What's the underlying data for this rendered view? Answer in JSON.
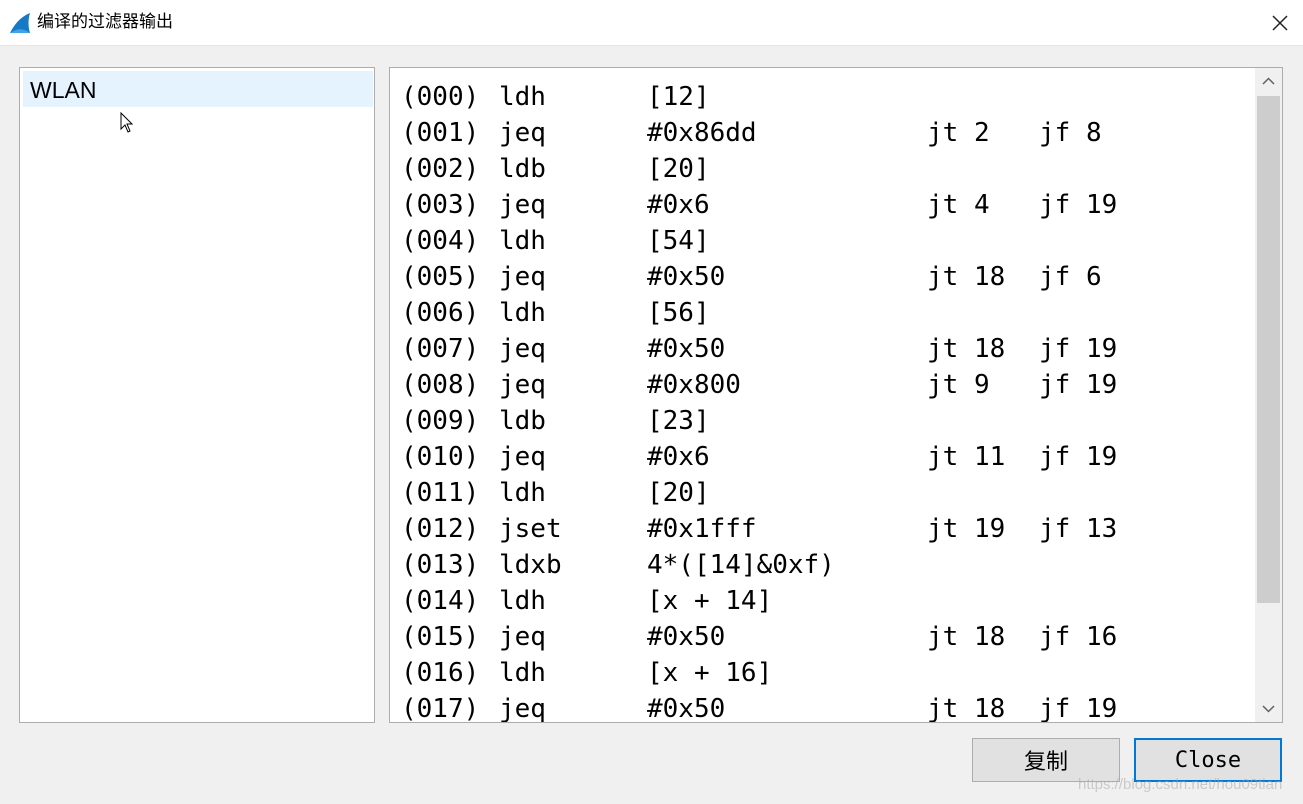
{
  "window": {
    "title": "编译的过滤器输出",
    "icon": "wireshark-fin-icon",
    "accent": "#0078d7"
  },
  "interfaces": {
    "items": [
      {
        "label": "WLAN",
        "selected": true
      }
    ]
  },
  "code": {
    "lines": [
      {
        "idx": "(000)",
        "op": "ldh",
        "arg": "[12]",
        "jt": "",
        "jf": ""
      },
      {
        "idx": "(001)",
        "op": "jeq",
        "arg": "#0x86dd",
        "jt": "jt 2",
        "jf": "jf 8"
      },
      {
        "idx": "(002)",
        "op": "ldb",
        "arg": "[20]",
        "jt": "",
        "jf": ""
      },
      {
        "idx": "(003)",
        "op": "jeq",
        "arg": "#0x6",
        "jt": "jt 4",
        "jf": "jf 19"
      },
      {
        "idx": "(004)",
        "op": "ldh",
        "arg": "[54]",
        "jt": "",
        "jf": ""
      },
      {
        "idx": "(005)",
        "op": "jeq",
        "arg": "#0x50",
        "jt": "jt 18",
        "jf": "jf 6"
      },
      {
        "idx": "(006)",
        "op": "ldh",
        "arg": "[56]",
        "jt": "",
        "jf": ""
      },
      {
        "idx": "(007)",
        "op": "jeq",
        "arg": "#0x50",
        "jt": "jt 18",
        "jf": "jf 19"
      },
      {
        "idx": "(008)",
        "op": "jeq",
        "arg": "#0x800",
        "jt": "jt 9",
        "jf": "jf 19"
      },
      {
        "idx": "(009)",
        "op": "ldb",
        "arg": "[23]",
        "jt": "",
        "jf": ""
      },
      {
        "idx": "(010)",
        "op": "jeq",
        "arg": "#0x6",
        "jt": "jt 11",
        "jf": "jf 19"
      },
      {
        "idx": "(011)",
        "op": "ldh",
        "arg": "[20]",
        "jt": "",
        "jf": ""
      },
      {
        "idx": "(012)",
        "op": "jset",
        "arg": "#0x1fff",
        "jt": "jt 19",
        "jf": "jf 13"
      },
      {
        "idx": "(013)",
        "op": "ldxb",
        "arg": "4*([14]&0xf)",
        "jt": "",
        "jf": ""
      },
      {
        "idx": "(014)",
        "op": "ldh",
        "arg": "[x + 14]",
        "jt": "",
        "jf": ""
      },
      {
        "idx": "(015)",
        "op": "jeq",
        "arg": "#0x50",
        "jt": "jt 18",
        "jf": "jf 16"
      },
      {
        "idx": "(016)",
        "op": "ldh",
        "arg": "[x + 16]",
        "jt": "",
        "jf": ""
      },
      {
        "idx": "(017)",
        "op": "jeq",
        "arg": "#0x50",
        "jt": "jt 18",
        "jf": "jf 19"
      }
    ]
  },
  "buttons": {
    "copy_label": "复制",
    "close_label": "Close"
  },
  "watermark": "https://blog.csdn.net/hou09tian"
}
